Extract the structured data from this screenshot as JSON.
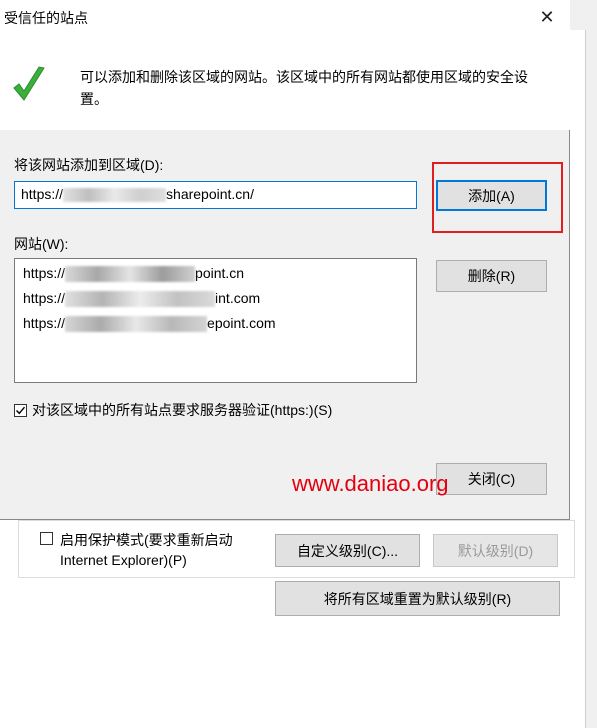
{
  "background_window": {
    "protected_mode_label_line1": "启用保护模式(要求重新启动",
    "protected_mode_label_line2": "Internet Explorer)(P)",
    "custom_level_button": "自定义级别(C)...",
    "default_level_button": "默认级别(D)",
    "reset_all_button": "将所有区域重置为默认级别(R)"
  },
  "dialog": {
    "title": "受信任的站点",
    "intro_text": "可以添加和删除该区域的网站。该区域中的所有网站都使用区域的安全设置。",
    "add_label": "将该网站添加到区域(D):",
    "add_input_prefix": "https://",
    "add_input_suffix": "sharepoint.cn/",
    "add_button": "添加(A)",
    "websites_label": "网站(W):",
    "remove_button": "删除(R)",
    "websites": [
      {
        "prefix": "https://",
        "suffix": "point.cn"
      },
      {
        "prefix": "https://",
        "suffix": "int.com"
      },
      {
        "prefix": "https://",
        "suffix": "epoint.com"
      }
    ],
    "require_https_label": "对该区域中的所有站点要求服务器验证(https:)(S)",
    "require_https_checked": true,
    "close_button": "关闭(C)"
  },
  "watermark": "www.daniao.org",
  "colors": {
    "highlight_box": "#e02020",
    "watermark": "#e3000f",
    "focus_blue": "#0078d7"
  }
}
